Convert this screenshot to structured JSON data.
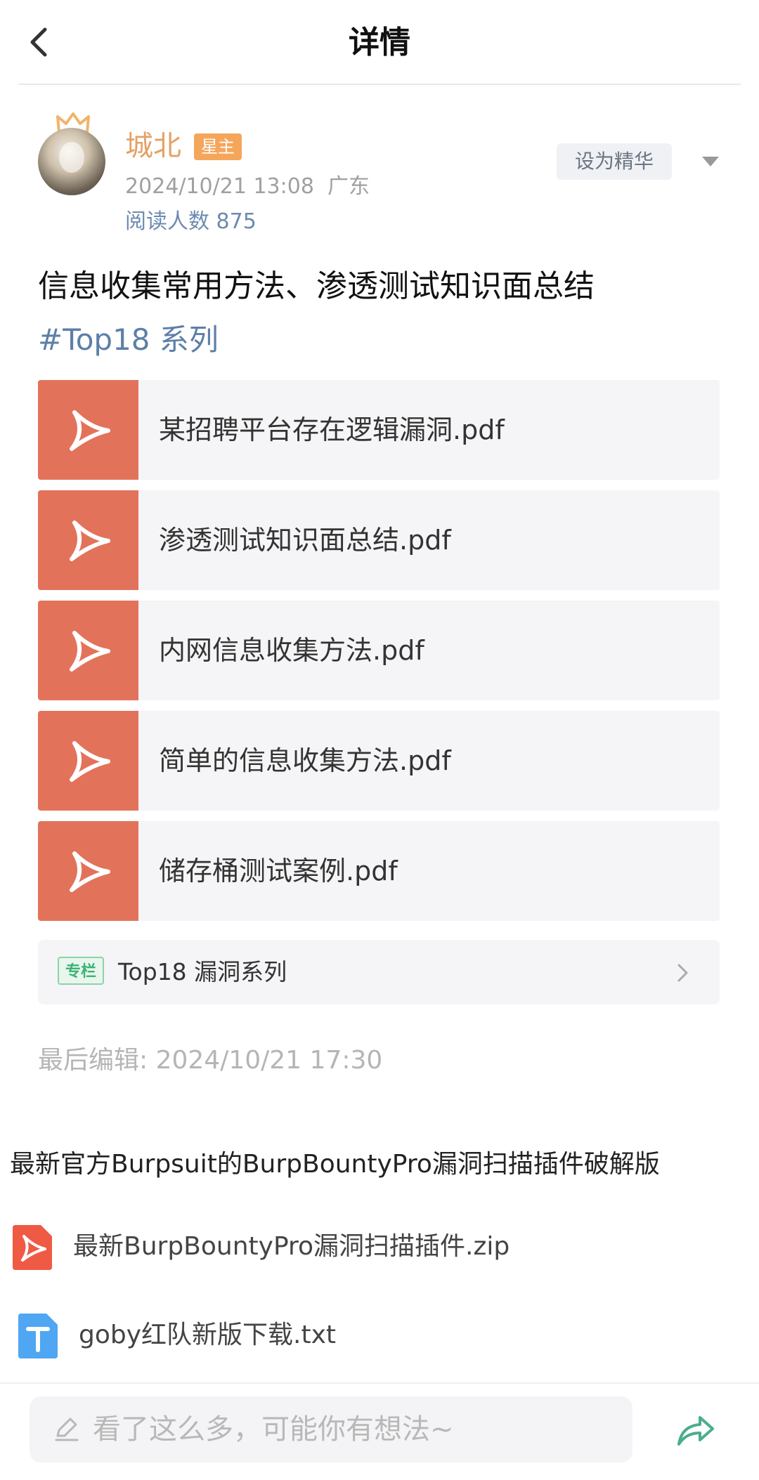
{
  "header": {
    "title": "详情"
  },
  "author": {
    "name": "城北",
    "badge": "星主",
    "datetime": "2024/10/21 13:08",
    "location": "广东",
    "read_label": "阅读人数",
    "read_count": "875"
  },
  "actions": {
    "essence_label": "设为精华"
  },
  "post": {
    "title": "信息收集常用方法、渗透测试知识面总结",
    "hashtag": "#Top18 系列",
    "files": [
      "某招聘平台存在逻辑漏洞.pdf",
      "渗透测试知识面总结.pdf",
      "内网信息收集方法.pdf",
      "简单的信息收集方法.pdf",
      "储存桶测试案例.pdf"
    ],
    "column": {
      "tag": "专栏",
      "title": "Top18 漏洞系列"
    },
    "last_edit": "最后编辑: 2024/10/21 17:30"
  },
  "section2": {
    "title": "最新官方Burpsuit的BurpBountyPro漏洞扫描插件破解版",
    "attachments": [
      {
        "name": "最新BurpBountyPro漏洞扫描插件.zip",
        "icon": "pdf-red-icon"
      },
      {
        "name": "goby红队新版下载.txt",
        "icon": "txt-blue-icon"
      }
    ]
  },
  "footer": {
    "comment_placeholder": "看了这么多，可能你有想法~"
  },
  "colors": {
    "accent_orange": "#e3a267",
    "pdf_red": "#e2735a",
    "link_blue": "#5d7fa8",
    "column_green": "#3cb371"
  }
}
